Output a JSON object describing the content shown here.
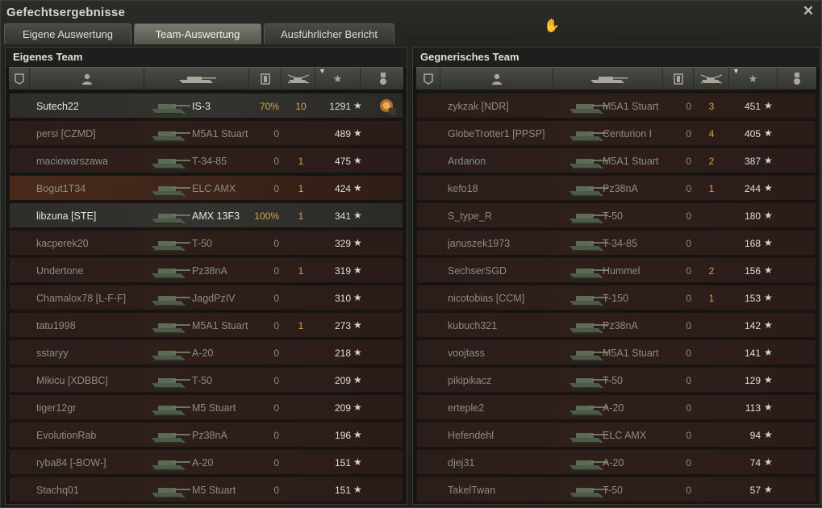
{
  "window": {
    "title": "Gefechtsergebnisse"
  },
  "tabs": [
    {
      "label": "Eigene Auswertung",
      "active": false
    },
    {
      "label": "Team-Auswertung",
      "active": true
    },
    {
      "label": "Ausführlicher Bericht",
      "active": false
    }
  ],
  "colors": {
    "kills": "#d6a44a",
    "alive_text": "#e7e4da",
    "dead_text": "#8f8b82"
  },
  "own_team": {
    "title": "Eigenes Team",
    "rows": [
      {
        "name": "Sutech22",
        "tank": "IS-3",
        "dmg": "70%",
        "kills": "10",
        "xp": "1291",
        "state": "self",
        "medal": true
      },
      {
        "name": "persi [CZMD]",
        "tank": "M5A1 Stuart",
        "dmg": "0",
        "kills": "",
        "xp": "489",
        "state": "dead"
      },
      {
        "name": "maciowarszawa",
        "tank": "T-34-85",
        "dmg": "0",
        "kills": "1",
        "xp": "475",
        "state": "dead"
      },
      {
        "name": "Bogut1T34",
        "tank": "ELC AMX",
        "dmg": "0",
        "kills": "1",
        "xp": "424",
        "state": "highlight"
      },
      {
        "name": "libzuna [STE]",
        "tank": "AMX 13F3",
        "dmg": "100%",
        "kills": "1",
        "xp": "341",
        "state": "self"
      },
      {
        "name": "kacperek20",
        "tank": "T-50",
        "dmg": "0",
        "kills": "",
        "xp": "329",
        "state": "dead"
      },
      {
        "name": "Undertone",
        "tank": "Pz38nA",
        "dmg": "0",
        "kills": "1",
        "xp": "319",
        "state": "dead"
      },
      {
        "name": "Chamalox78 [L-F-F]",
        "tank": "JagdPzIV",
        "dmg": "0",
        "kills": "",
        "xp": "310",
        "state": "dead"
      },
      {
        "name": "tatu1998",
        "tank": "M5A1 Stuart",
        "dmg": "0",
        "kills": "1",
        "xp": "273",
        "state": "dead"
      },
      {
        "name": "sstaryy",
        "tank": "A-20",
        "dmg": "0",
        "kills": "",
        "xp": "218",
        "state": "dead"
      },
      {
        "name": "Mikicu [XDBBC]",
        "tank": "T-50",
        "dmg": "0",
        "kills": "",
        "xp": "209",
        "state": "dead"
      },
      {
        "name": "tiger12gr",
        "tank": "M5 Stuart",
        "dmg": "0",
        "kills": "",
        "xp": "209",
        "state": "dead"
      },
      {
        "name": "EvolutionRab",
        "tank": "Pz38nA",
        "dmg": "0",
        "kills": "",
        "xp": "196",
        "state": "dead"
      },
      {
        "name": "ryba84 [-BOW-]",
        "tank": "A-20",
        "dmg": "0",
        "kills": "",
        "xp": "151",
        "state": "dead"
      },
      {
        "name": "Stachq01",
        "tank": "M5 Stuart",
        "dmg": "0",
        "kills": "",
        "xp": "151",
        "state": "dead"
      }
    ]
  },
  "enemy_team": {
    "title": "Gegnerisches Team",
    "rows": [
      {
        "name": "zykzak [NDR]",
        "tank": "M5A1 Stuart",
        "dmg": "0",
        "kills": "3",
        "xp": "451",
        "state": "dead"
      },
      {
        "name": "GlobeTrotter1 [PPSP]",
        "tank": "Centurion I",
        "dmg": "0",
        "kills": "4",
        "xp": "405",
        "state": "dead"
      },
      {
        "name": "Ardarion",
        "tank": "M5A1 Stuart",
        "dmg": "0",
        "kills": "2",
        "xp": "387",
        "state": "dead"
      },
      {
        "name": "kefo18",
        "tank": "Pz38nA",
        "dmg": "0",
        "kills": "1",
        "xp": "244",
        "state": "dead"
      },
      {
        "name": "S_type_R",
        "tank": "T-50",
        "dmg": "0",
        "kills": "",
        "xp": "180",
        "state": "dead"
      },
      {
        "name": "januszek1973",
        "tank": "T-34-85",
        "dmg": "0",
        "kills": "",
        "xp": "168",
        "state": "dead"
      },
      {
        "name": "SechserSGD",
        "tank": "Hummel",
        "dmg": "0",
        "kills": "2",
        "xp": "156",
        "state": "dead"
      },
      {
        "name": "nicotobias [CCM]",
        "tank": "T-150",
        "dmg": "0",
        "kills": "1",
        "xp": "153",
        "state": "dead"
      },
      {
        "name": "kubuch321",
        "tank": "Pz38nA",
        "dmg": "0",
        "kills": "",
        "xp": "142",
        "state": "dead"
      },
      {
        "name": "voojtass",
        "tank": "M5A1 Stuart",
        "dmg": "0",
        "kills": "",
        "xp": "141",
        "state": "dead"
      },
      {
        "name": "pikipikacz",
        "tank": "T-50",
        "dmg": "0",
        "kills": "",
        "xp": "129",
        "state": "dead"
      },
      {
        "name": "erteple2",
        "tank": "A-20",
        "dmg": "0",
        "kills": "",
        "xp": "113",
        "state": "dead"
      },
      {
        "name": "Hefendehl",
        "tank": "ELC AMX",
        "dmg": "0",
        "kills": "",
        "xp": "94",
        "state": "dead"
      },
      {
        "name": "djej31",
        "tank": "A-20",
        "dmg": "0",
        "kills": "",
        "xp": "74",
        "state": "dead"
      },
      {
        "name": "TakelTwan",
        "tank": "T-50",
        "dmg": "0",
        "kills": "",
        "xp": "57",
        "state": "dead"
      }
    ]
  },
  "medal": {
    "count": "4"
  }
}
